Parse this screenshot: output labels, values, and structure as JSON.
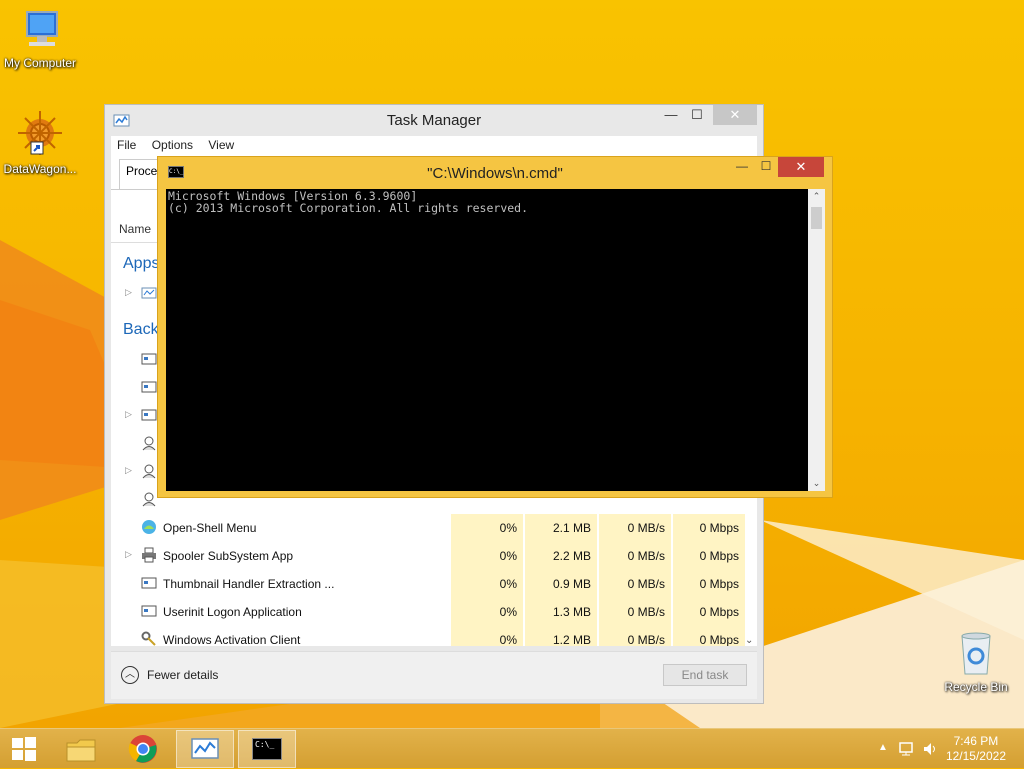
{
  "desktop": {
    "icons": [
      {
        "label": "My Computer"
      },
      {
        "label": "DataWagon..."
      },
      {
        "label": "Recycle Bin"
      }
    ]
  },
  "task_manager": {
    "title": "Task Manager",
    "menu": [
      "File",
      "Options",
      "View"
    ],
    "tab_label": "Proces",
    "column_name": "Name",
    "sections": {
      "apps": "Apps",
      "background": "Back"
    },
    "rows": [
      {
        "name": "Open-Shell Menu",
        "cpu": "0%",
        "memory": "2.1 MB",
        "disk": "0 MB/s",
        "network": "0 Mbps"
      },
      {
        "name": "Spooler SubSystem App",
        "cpu": "0%",
        "memory": "2.2 MB",
        "disk": "0 MB/s",
        "network": "0 Mbps"
      },
      {
        "name": "Thumbnail Handler Extraction ...",
        "cpu": "0%",
        "memory": "0.9 MB",
        "disk": "0 MB/s",
        "network": "0 Mbps"
      },
      {
        "name": "Userinit Logon Application",
        "cpu": "0%",
        "memory": "1.3 MB",
        "disk": "0 MB/s",
        "network": "0 Mbps"
      },
      {
        "name": "Windows Activation Client",
        "cpu": "0%",
        "memory": "1.2 MB",
        "disk": "0 MB/s",
        "network": "0 Mbps"
      }
    ],
    "fewer_details": "Fewer details",
    "end_task": "End task"
  },
  "cmd": {
    "title": "\"C:\\Windows\\n.cmd\"",
    "icon_text": "C:\\_",
    "lines": [
      "Microsoft Windows [Version 6.3.9600]",
      "(c) 2013 Microsoft Corporation. All rights reserved."
    ]
  },
  "window_controls": {
    "minimize": "—",
    "maximize": "☐",
    "close": "✕"
  },
  "taskbar": {
    "clock_time": "7:46 PM",
    "clock_date": "12/15/2022",
    "cmd_icon_text": "C:\\_"
  }
}
